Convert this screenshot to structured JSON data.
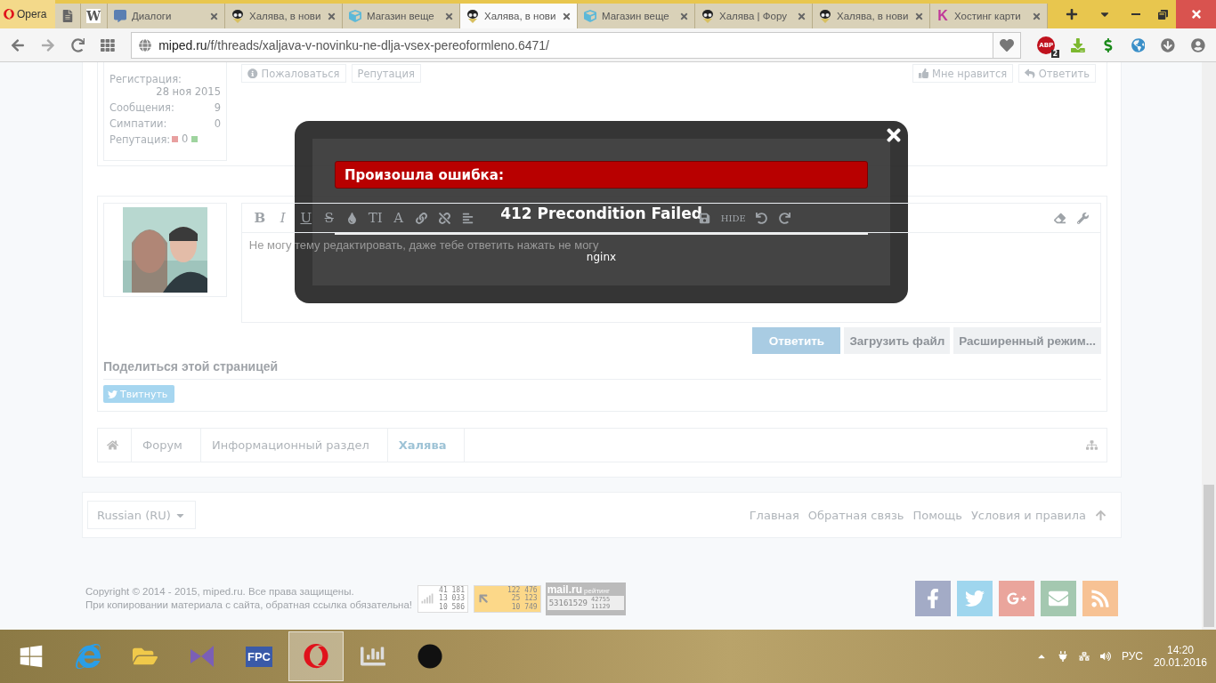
{
  "browser": {
    "menu_label": "Opera",
    "tabs": [
      {
        "kind": "doc",
        "selected": false
      },
      {
        "kind": "wiki",
        "label": "W",
        "selected": false
      },
      {
        "kind": "chat",
        "label": "Диалоги",
        "selected": false
      },
      {
        "kind": "mascot",
        "label": "Халява, в нови",
        "selected": false
      },
      {
        "kind": "cube",
        "label": "Магазин веще",
        "selected": false
      },
      {
        "kind": "mascot",
        "label": "Халява, в нови",
        "selected": true
      },
      {
        "kind": "cube",
        "label": "Магазин веще",
        "selected": false
      },
      {
        "kind": "mascot",
        "label": "Халява | Фору",
        "selected": false
      },
      {
        "kind": "mascot",
        "label": "Халява, в нови",
        "selected": false
      },
      {
        "kind": "letter",
        "label": "K",
        "label_text": "Хостинг карти",
        "selected": false
      }
    ],
    "address": {
      "domain": "miped.ru",
      "path": "/f/threads/xaljava-v-novinku-ne-dlja-vsex-pereoformleno.6471/"
    },
    "adblock_label": "ABP",
    "adblock_count": "2"
  },
  "user_info": [
    {
      "label": "Регистрация:",
      "value": "28 ноя 2015",
      "stacked": true
    },
    {
      "label": "Сообщения:",
      "value": "9",
      "stacked": false
    },
    {
      "label": "Симпатии:",
      "value": "0",
      "stacked": false
    }
  ],
  "reputation": {
    "label": "Репутация:",
    "value": "0"
  },
  "post_actions_left": [
    "Пожаловаться",
    "Репутация"
  ],
  "post_actions_right": [
    "Мне нравится",
    "Ответить"
  ],
  "editor": {
    "toolbar_left": [
      {
        "kind": "bold",
        "label": "B"
      },
      {
        "kind": "italic",
        "label": "I"
      },
      {
        "kind": "underline",
        "label": "U"
      },
      {
        "kind": "strike",
        "label": "S"
      },
      {
        "kind": "drop"
      },
      {
        "kind": "glyph",
        "label": "TI"
      },
      {
        "kind": "glyph",
        "label": "A"
      },
      {
        "kind": "link"
      },
      {
        "kind": "unlink"
      },
      {
        "kind": "align"
      }
    ],
    "toolbar_middle": [
      {
        "kind": "save"
      },
      {
        "kind": "small",
        "label": "HIDE"
      },
      {
        "kind": "undo"
      },
      {
        "kind": "redo"
      }
    ],
    "toolbar_right": [
      {
        "kind": "eraser"
      },
      {
        "kind": "wrench"
      }
    ],
    "text": "Не могу тему редактировать, даже тебе ответить нажать не могу"
  },
  "reply_buttons": [
    {
      "label": "Ответить",
      "primary": true
    },
    {
      "label": "Загрузить файл",
      "primary": false
    },
    {
      "label": "Расширенный режим...",
      "primary": false
    }
  ],
  "share": {
    "title": "Поделиться этой страницей",
    "tweet": "Твитнуть"
  },
  "breadcrumb": [
    {
      "label": "Форум",
      "current": false
    },
    {
      "label": "Информационный раздел",
      "current": false
    },
    {
      "label": "Халява",
      "current": true
    }
  ],
  "footer": {
    "language": "Russian (RU)",
    "links": [
      "Главная",
      "Обратная связь",
      "Помощь",
      "Условия и правила"
    ]
  },
  "copyright": [
    "Copyright © 2014 - 2015, miped.ru. Все права защищены.",
    "При копировании материала с сайта, обратная ссылка обязательна!"
  ],
  "counters": {
    "first": [
      "41 181",
      "13 033",
      "10 586"
    ],
    "second": [
      "122 476",
      "25 123",
      "10 749"
    ],
    "mail_logo": "mail.ru",
    "mail_rating": "рейтинг",
    "mail_total": "53161529",
    "mail_numbers": [
      "42755",
      "11129"
    ]
  },
  "social": [
    {
      "kind": "facebook",
      "color": "#a3abc6"
    },
    {
      "kind": "twitter",
      "color": "#9fd6ee"
    },
    {
      "kind": "google",
      "color": "#eaa59c"
    },
    {
      "kind": "mail",
      "color": "#a4c8b0"
    },
    {
      "kind": "rss",
      "color": "#f7c294"
    }
  ],
  "modal": {
    "heading": "Произошла ошибка:",
    "title": "412 Precondition Failed",
    "server": "nginx"
  },
  "taskbar": {
    "apps": [
      {
        "kind": "explorer-ie",
        "active": false
      },
      {
        "kind": "folder",
        "active": false
      },
      {
        "kind": "studio",
        "active": false
      },
      {
        "kind": "pascal",
        "label": "FPC",
        "active": false
      },
      {
        "kind": "opera",
        "active": true
      },
      {
        "kind": "monitor",
        "active": false
      },
      {
        "kind": "disc",
        "active": false
      }
    ],
    "language": "РУС",
    "time": "14:20",
    "date": "20.01.2016"
  }
}
